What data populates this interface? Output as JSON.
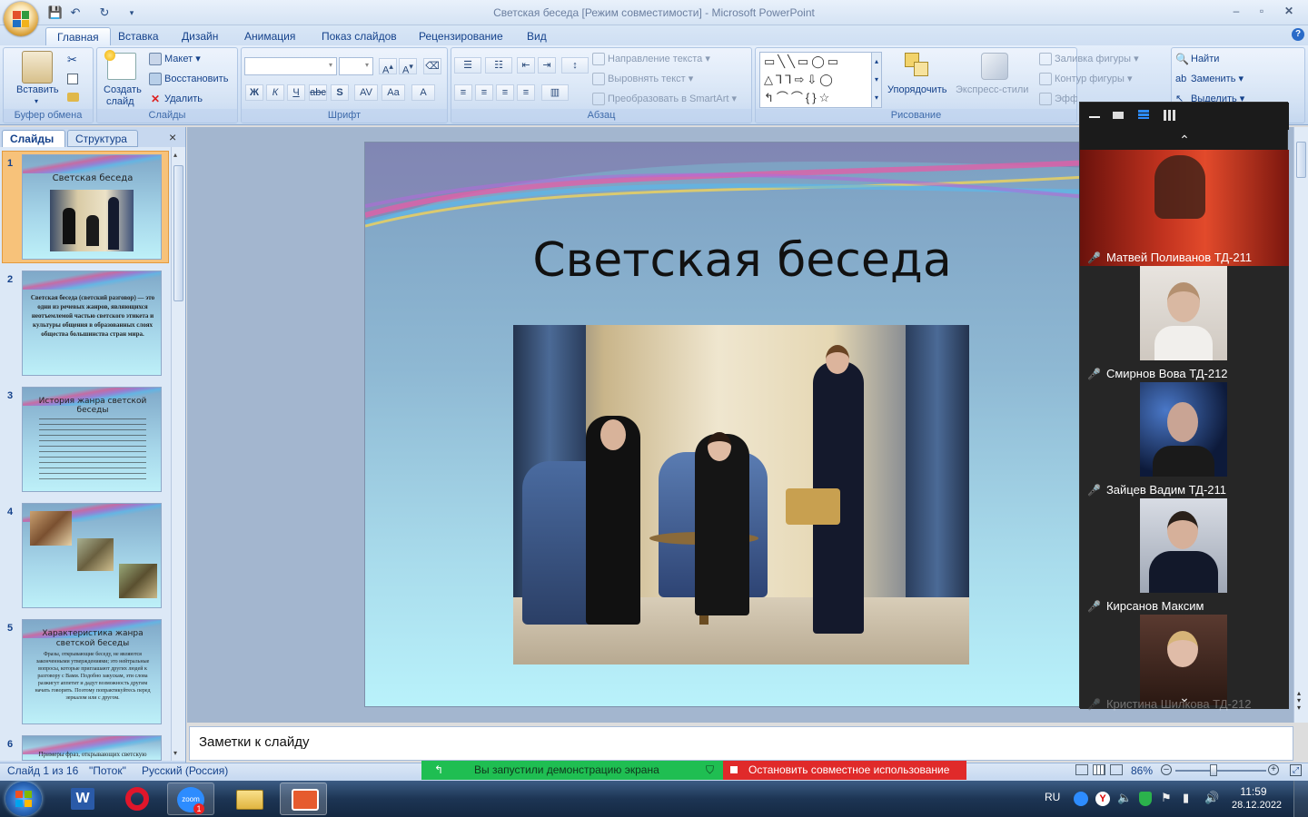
{
  "window": {
    "title": "Светская беседа [Режим совместимости] - Microsoft PowerPoint"
  },
  "tabs": [
    "Главная",
    "Вставка",
    "Дизайн",
    "Анимация",
    "Показ слайдов",
    "Рецензирование",
    "Вид"
  ],
  "ribbon": {
    "clipboard": {
      "paste": "Вставить",
      "label": "Буфер обмена"
    },
    "slides": {
      "create": "Создать",
      "create2": "слайд",
      "layout": "Макет",
      "reset": "Восстановить",
      "delete": "Удалить",
      "label": "Слайды"
    },
    "font": {
      "label": "Шрифт"
    },
    "paragraph": {
      "text_dir": "Направление текста",
      "align_text": "Выровнять текст",
      "smartart": "Преобразовать в SmartArt",
      "label": "Абзац"
    },
    "drawing": {
      "arrange": "Упорядочить",
      "quick_styles": "Экспресс-стили",
      "fill": "Заливка фигуры",
      "outline": "Контур фигуры",
      "effects": "Эффекты для фигур",
      "label": "Рисование"
    },
    "editing": {
      "find": "Найти",
      "replace": "Заменить",
      "select": "Выделить"
    }
  },
  "panel": {
    "tab_slides": "Слайды",
    "tab_outline": "Структура",
    "close": "×",
    "thumbs": [
      {
        "num": "1",
        "title": "Светская беседа"
      },
      {
        "num": "2",
        "text": "Светская беседа (светский разговор) — это одни из речевых жанров, являющихся неотъемлемой частью светского этикета и культуры общения в образованных слоях общества большинства стран мира."
      },
      {
        "num": "3",
        "title": "История жанра светской беседы"
      },
      {
        "num": "4"
      },
      {
        "num": "5",
        "title": "Характеристика жанра светской беседы",
        "text": "Фразы, открывающие беседу, не являются законченными утверждениями; это нейтральные вопросы, которые приглашают других людей к разговору с Вами. Подобно закускам, эти слова разжигут аппетит и дадут возможность другим начать говорить. Поэтому попрактикуйтесь перед зеркалом или с другом."
      },
      {
        "num": "6",
        "text": "Примеры фраз, открывающих светскую"
      }
    ]
  },
  "slide": {
    "title": "Светская беседа"
  },
  "notes": {
    "placeholder": "Заметки к слайду"
  },
  "status": {
    "slide": "Слайд 1 из 16",
    "theme": "\"Поток\"",
    "lang": "Русский (Россия)",
    "zoom": "86%"
  },
  "share": {
    "running": "Вы запустили демонстрацию экрана",
    "stop": "Остановить совместное использование"
  },
  "zoom_participants": [
    {
      "name": "Матвей Поливанов ТД-211"
    },
    {
      "name": "Смирнов Вова ТД-212"
    },
    {
      "name": "Зайцев Вадим ТД-211"
    },
    {
      "name": "Кирсанов Максим"
    },
    {
      "name": "Кристина Шилкова ТД-212"
    }
  ],
  "taskbar": {
    "lang": "RU",
    "time": "11:59",
    "date": "28.12.2022",
    "zoom_badge": "1"
  }
}
